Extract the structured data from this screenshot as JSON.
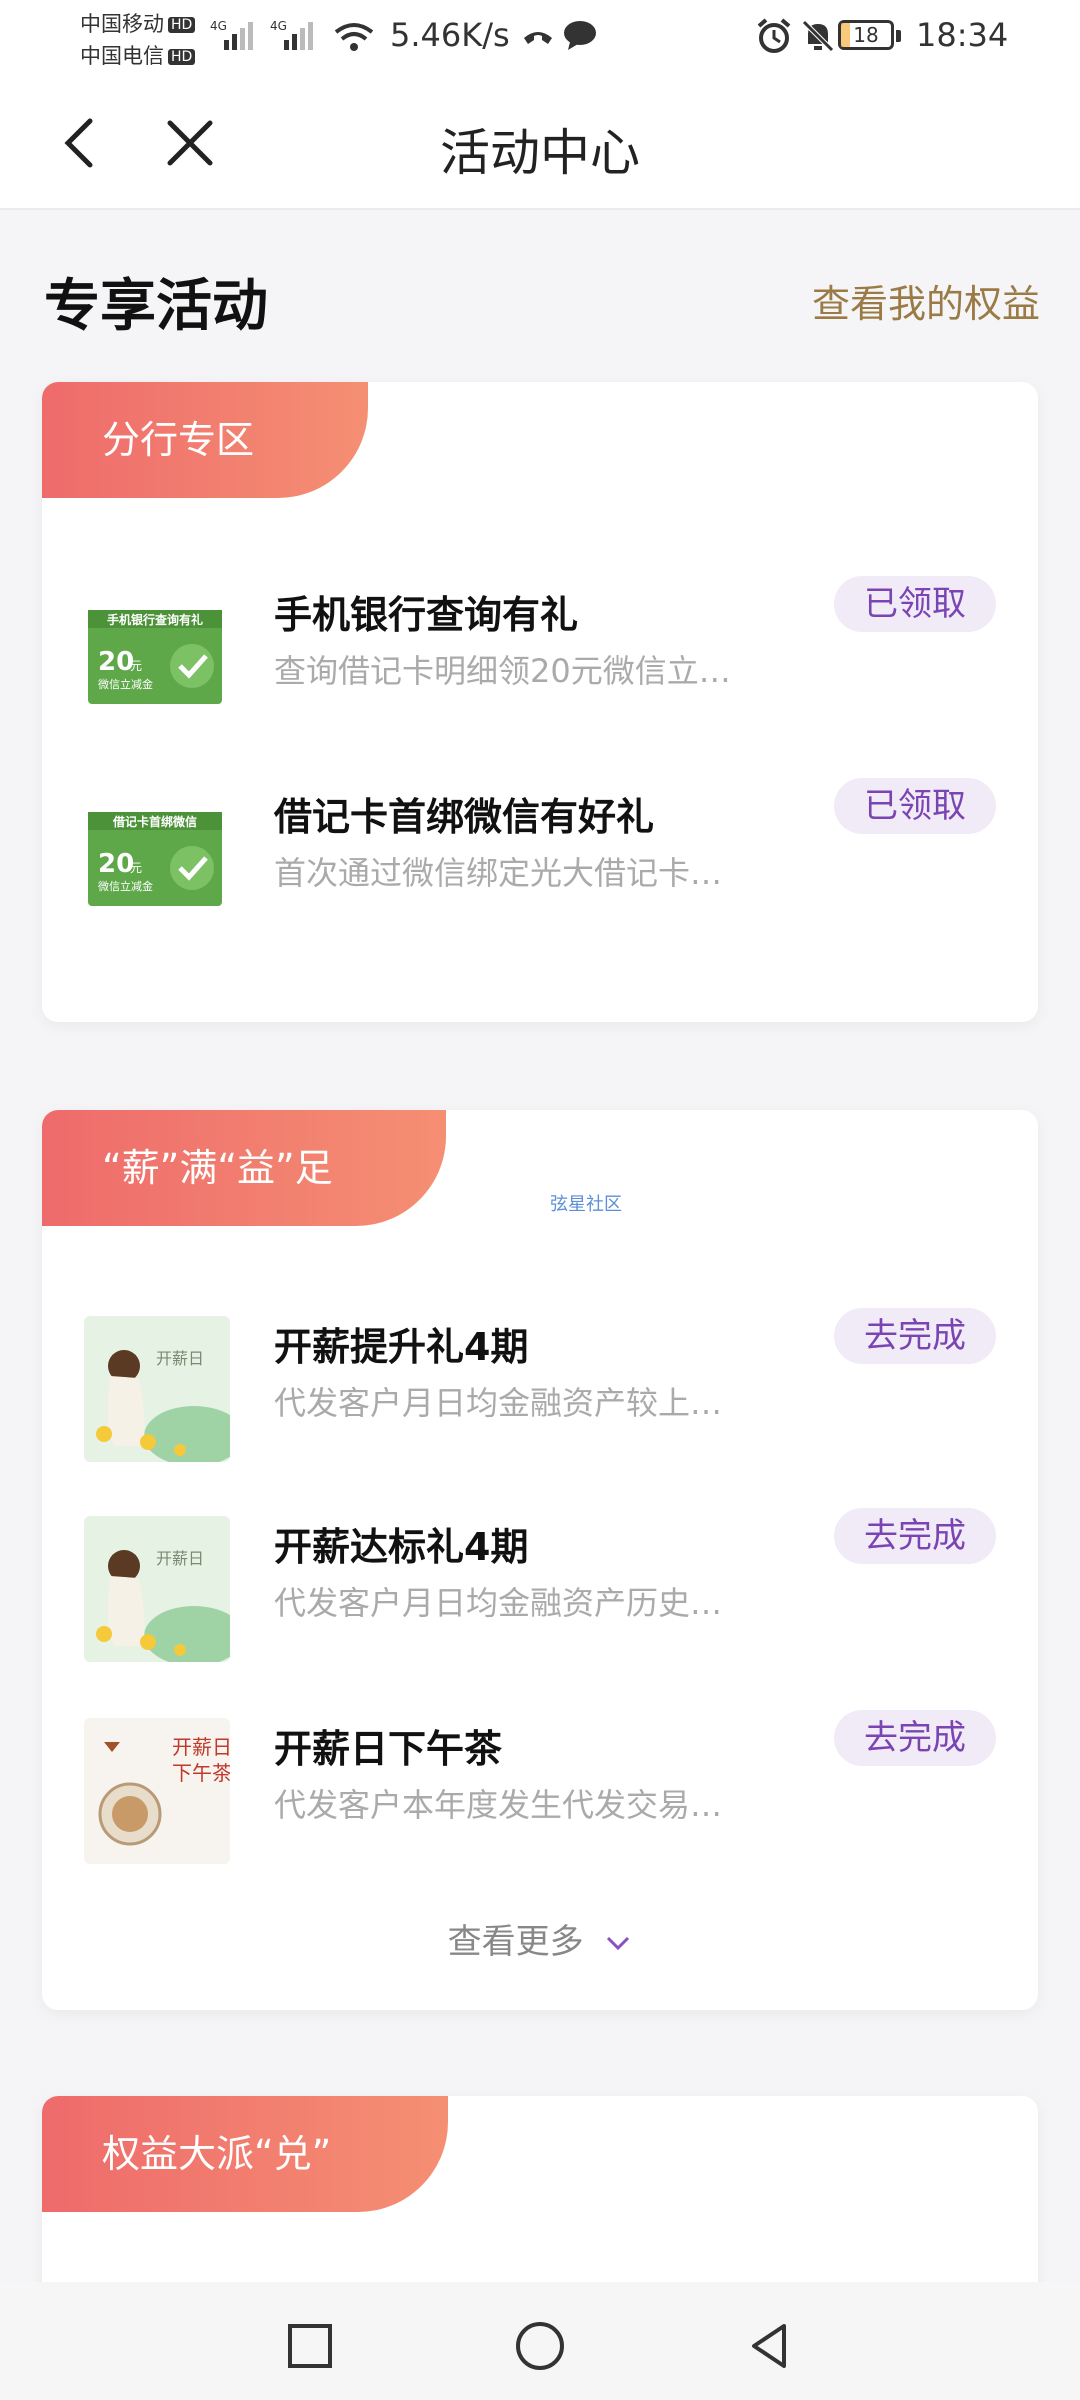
{
  "status_bar": {
    "carrier1": "中国移动",
    "carrier2": "中国电信",
    "hd": "HD",
    "signal": "4G",
    "net_speed": "5.46K/s",
    "battery": "18",
    "battery_level": 0.18,
    "time": "18:34"
  },
  "nav": {
    "title": "活动中心",
    "back_icon": "chevron-left-icon",
    "close_icon": "close-icon"
  },
  "section": {
    "title": "专享活动",
    "link": "查看我的权益"
  },
  "cards": [
    {
      "tab": "分行专区",
      "rows": [
        {
          "title": "手机银行查询有礼",
          "desc": "查询借记卡明细领20元微信立…",
          "button": "已领取",
          "thumb": {
            "header": "手机银行查询有礼",
            "amount": "20",
            "unit": "元",
            "sub": "微信立减金"
          }
        },
        {
          "title": "借记卡首绑微信有好礼",
          "desc": "首次通过微信绑定光大借记卡…",
          "button": "已领取",
          "thumb": {
            "header": "借记卡首绑微信",
            "amount": "20",
            "unit": "元",
            "sub": "微信立减金"
          }
        }
      ]
    },
    {
      "tab": "“薪”满“益”足",
      "watermark": "弦星社区",
      "rows": [
        {
          "title": "开薪提升礼4期",
          "desc": "代发客户月日均金融资产较上…",
          "button": "去完成",
          "thumb": {
            "label": "开薪日"
          }
        },
        {
          "title": "开薪达标礼4期",
          "desc": "代发客户月日均金融资产历史…",
          "button": "去完成",
          "thumb": {
            "label": "开薪日"
          }
        },
        {
          "title": "开薪日下午茶",
          "desc": "代发客户本年度发生代发交易…",
          "button": "去完成",
          "thumb": {
            "line1": "开薪日",
            "line2": "下午茶"
          }
        }
      ],
      "more": "查看更多"
    },
    {
      "tab": "权益大派“兑”"
    }
  ],
  "colors": {
    "accent_purple": "#7a45b2",
    "gold": "#9a7a45",
    "tab_gradient_start": "#ee6b6b",
    "tab_gradient_end": "#f58f73"
  }
}
